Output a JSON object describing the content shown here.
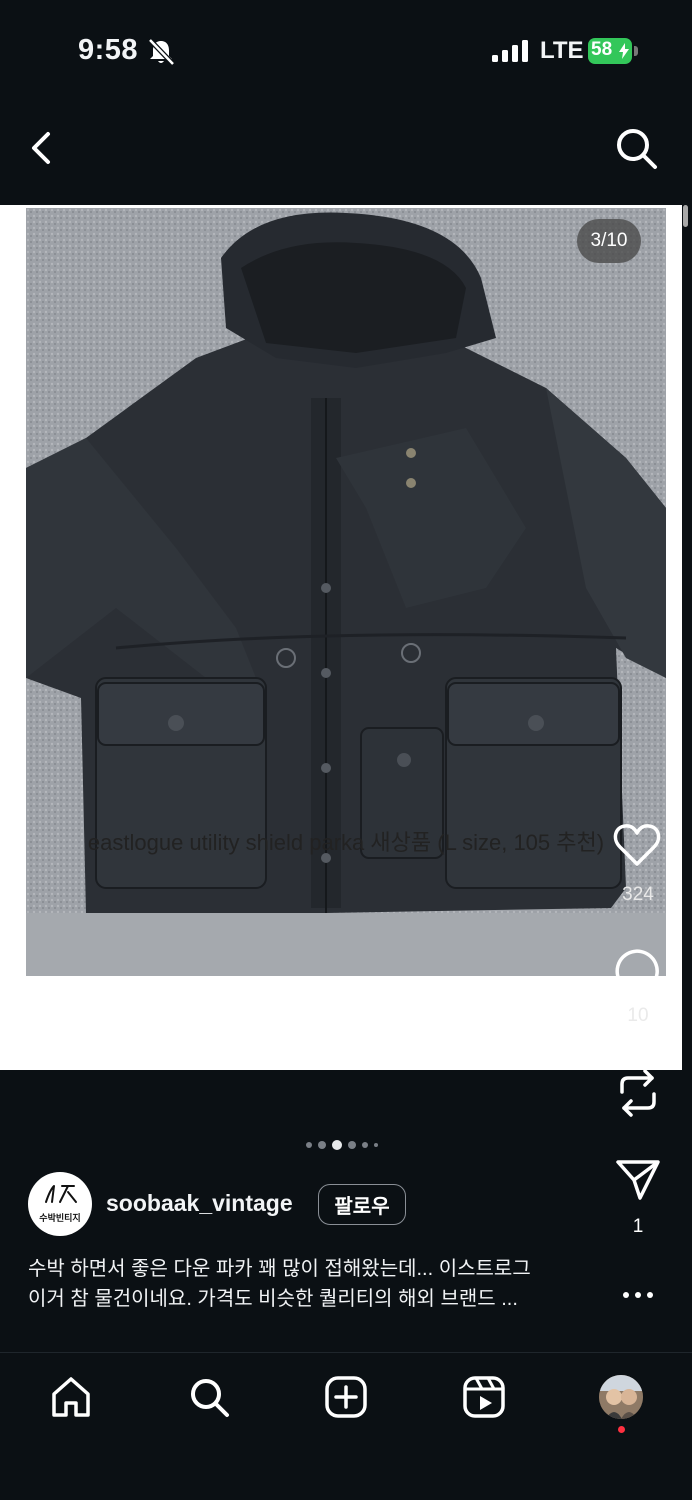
{
  "status_bar": {
    "time": "9:58",
    "network": "LTE",
    "battery": "58"
  },
  "post": {
    "page_counter": "3/10",
    "caption": "eastlogue utility shield parka 새상품 (L size, 105 추천)",
    "image_alt": "jacket-photo"
  },
  "actions": {
    "like_count": "324",
    "comment_count": "10",
    "share_count": "1"
  },
  "author": {
    "username": "soobaak_vintage",
    "avatar_text": "수박빈티지",
    "follow_label": "팔로우"
  },
  "description": {
    "line1": "수박 하면서 좋은 다운 파카 꽤 많이 접해왔는데... 이스트로그",
    "line2": "이거 참 물건이네요. 가격도 비슷한 퀄리티의 해외 브랜드 ..."
  },
  "carousel": {
    "total_dots": 6,
    "active_index": 2
  },
  "colors": {
    "background": "#0b1014",
    "battery": "#33c75a",
    "notification": "#ff3040"
  },
  "icons": [
    "bell-off-icon",
    "signal-icon",
    "battery-icon",
    "back-icon",
    "search-icon",
    "heart-icon",
    "comment-icon",
    "repost-icon",
    "send-icon",
    "more-icon",
    "home-icon",
    "create-icon",
    "reels-icon"
  ]
}
